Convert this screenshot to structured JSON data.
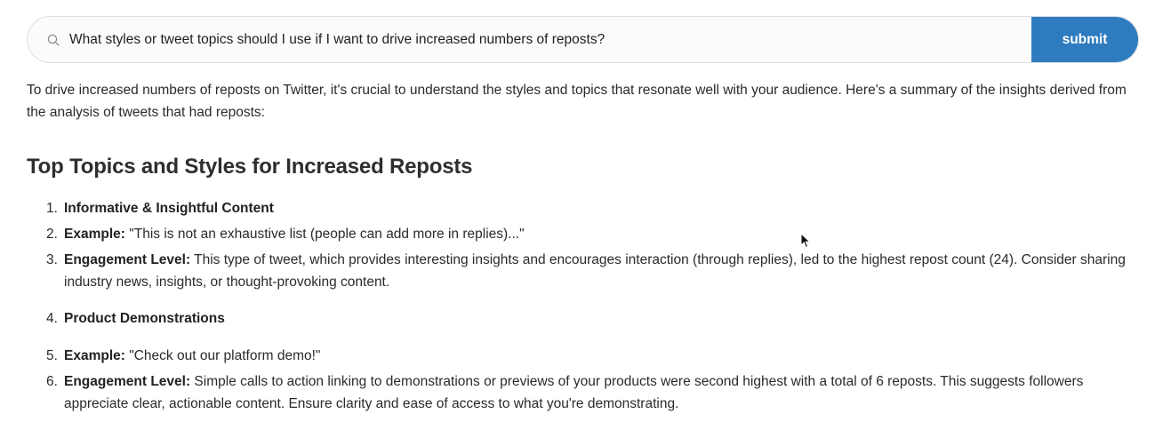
{
  "search": {
    "value": "What styles or tweet topics should I use if I want to drive increased numbers of reposts?",
    "icon": "search-icon",
    "submit_label": "submit"
  },
  "answer": {
    "intro": "To drive increased numbers of reposts on Twitter, it's crucial to understand the styles and topics that resonate well with your audience. Here's a summary of the insights derived from the analysis of tweets that had reposts:",
    "heading": "Top Topics and Styles for Increased Reposts",
    "items": [
      {
        "number": "1.",
        "bold": "Informative & Insightful Content",
        "text": ""
      },
      {
        "number": "2.",
        "bold": "Example:",
        "text": " \"This is not an exhaustive list (people can add more in replies)...\""
      },
      {
        "number": "3.",
        "bold": "Engagement Level:",
        "text": " This type of tweet, which provides interesting insights and encourages interaction (through replies), led to the highest repost count (24). Consider sharing industry news, insights, or thought-provoking content."
      },
      {
        "number": "4.",
        "bold": "Product Demonstrations",
        "text": ""
      },
      {
        "number": "5.",
        "bold": "Example:",
        "text": " \"Check out our platform demo!\""
      },
      {
        "number": "6.",
        "bold": "Engagement Level:",
        "text": " Simple calls to action linking to demonstrations or previews of your products were second highest with a total of 6 reposts. This suggests followers appreciate clear, actionable content. Ensure clarity and ease of access to what you're demonstrating."
      }
    ]
  },
  "colors": {
    "accent": "#2f7bbf",
    "text": "#2b2b2b",
    "border": "#dcdfe4"
  }
}
